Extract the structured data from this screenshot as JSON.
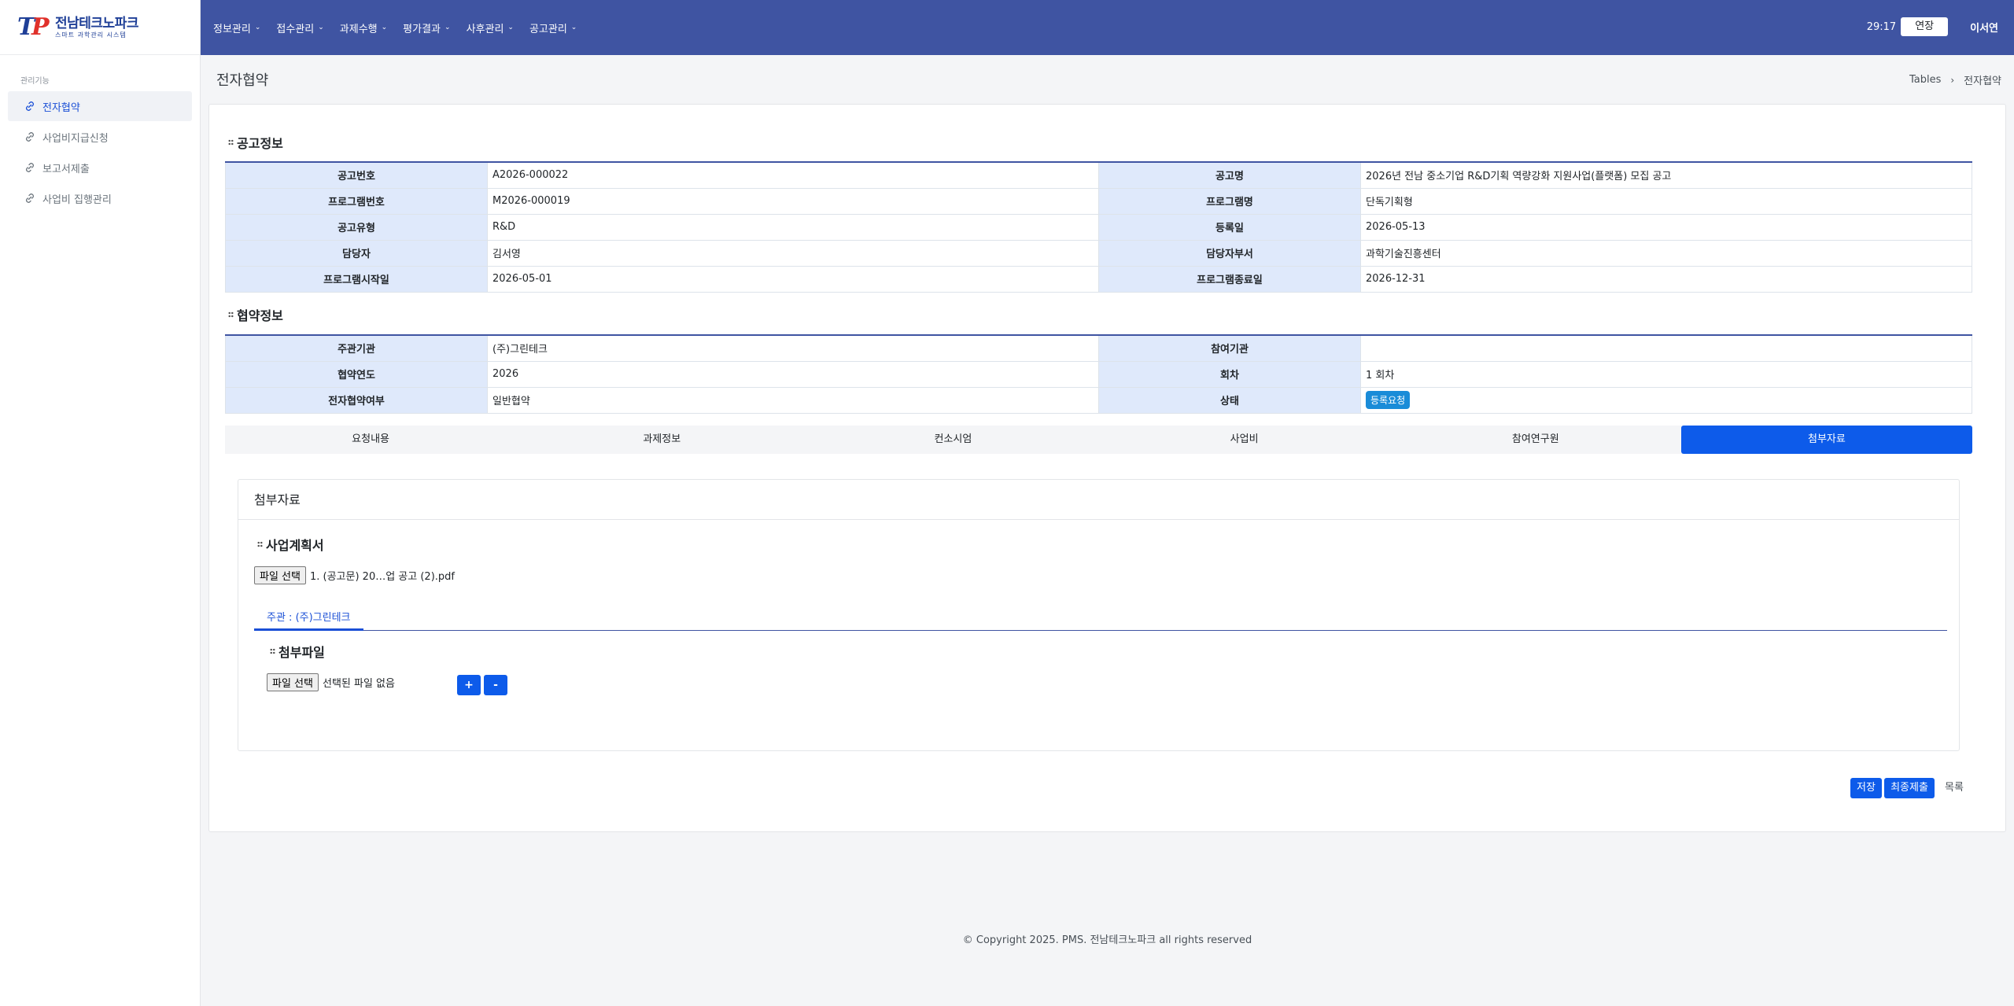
{
  "logo": {
    "main": "전남테크노파크",
    "sub": "스마트 과학관리 시스템"
  },
  "sidebar": {
    "title": "관리기능",
    "items": [
      {
        "label": "전자협약"
      },
      {
        "label": "사업비지급신청"
      },
      {
        "label": "보고서제출"
      },
      {
        "label": "사업비 집행관리"
      }
    ]
  },
  "topnav": {
    "items": [
      {
        "label": "정보관리"
      },
      {
        "label": "접수관리"
      },
      {
        "label": "과제수행"
      },
      {
        "label": "평가결과"
      },
      {
        "label": "사후관리"
      },
      {
        "label": "공고관리"
      }
    ],
    "timer": "29:17",
    "extend_label": "연장",
    "username": "이서연"
  },
  "page": {
    "title": "전자협약",
    "breadcrumb": [
      "Tables",
      "전자협약"
    ]
  },
  "notice": {
    "heading": "공고정보",
    "rows": [
      {
        "l1": "공고번호",
        "v1": "A2026-000022",
        "l2": "공고명",
        "v2": "2026년 전남 중소기업 R&D기획 역량강화 지원사업(플랫폼) 모집 공고"
      },
      {
        "l1": "프로그램번호",
        "v1": "M2026-000019",
        "l2": "프로그램명",
        "v2": "단독기획형"
      },
      {
        "l1": "공고유형",
        "v1": "R&D",
        "l2": "등록일",
        "v2": "2026-05-13"
      },
      {
        "l1": "담당자",
        "v1": "김서영",
        "l2": "담당자부서",
        "v2": "과학기술진흥센터"
      },
      {
        "l1": "프로그램시작일",
        "v1": "2026-05-01",
        "l2": "프로그램종료일",
        "v2": "2026-12-31"
      }
    ]
  },
  "agreement": {
    "heading": "협약정보",
    "rows": [
      {
        "l1": "주관기관",
        "v1": "(주)그린테크",
        "l2": "참여기관",
        "v2": ""
      },
      {
        "l1": "협약연도",
        "v1": "2026",
        "l2": "회차",
        "v2": "1 회차"
      },
      {
        "l1": "전자협약여부",
        "v1": "일반협약",
        "l2": "상태",
        "v2": ""
      }
    ],
    "status_badge": "등록요청"
  },
  "tabs": [
    {
      "label": "요청내용"
    },
    {
      "label": "과제정보"
    },
    {
      "label": "컨소시엄"
    },
    {
      "label": "사업비"
    },
    {
      "label": "참여연구원"
    },
    {
      "label": "첨부자료"
    }
  ],
  "attachments": {
    "title": "첨부자료",
    "plan_heading": "사업계획서",
    "file_button": "파일 선택",
    "plan_file": "1. (공고문) 20…업 공고 (2).pdf",
    "org_tab": "주관 : (주)그린테크",
    "attach_heading": "첨부파일",
    "no_file": "선택된 파일 없음",
    "add_label": "+",
    "remove_label": "-"
  },
  "actions": {
    "save": "저장",
    "final_submit": "최종제출",
    "list": "목록"
  },
  "footer": "© Copyright 2025. PMS. 전남테크노파크 all rights reserved",
  "colors": {
    "topbar": "#3f54a2",
    "accent": "#0d5bea",
    "header_cell": "#dfe9fb",
    "badge": "#1a8cd8"
  }
}
